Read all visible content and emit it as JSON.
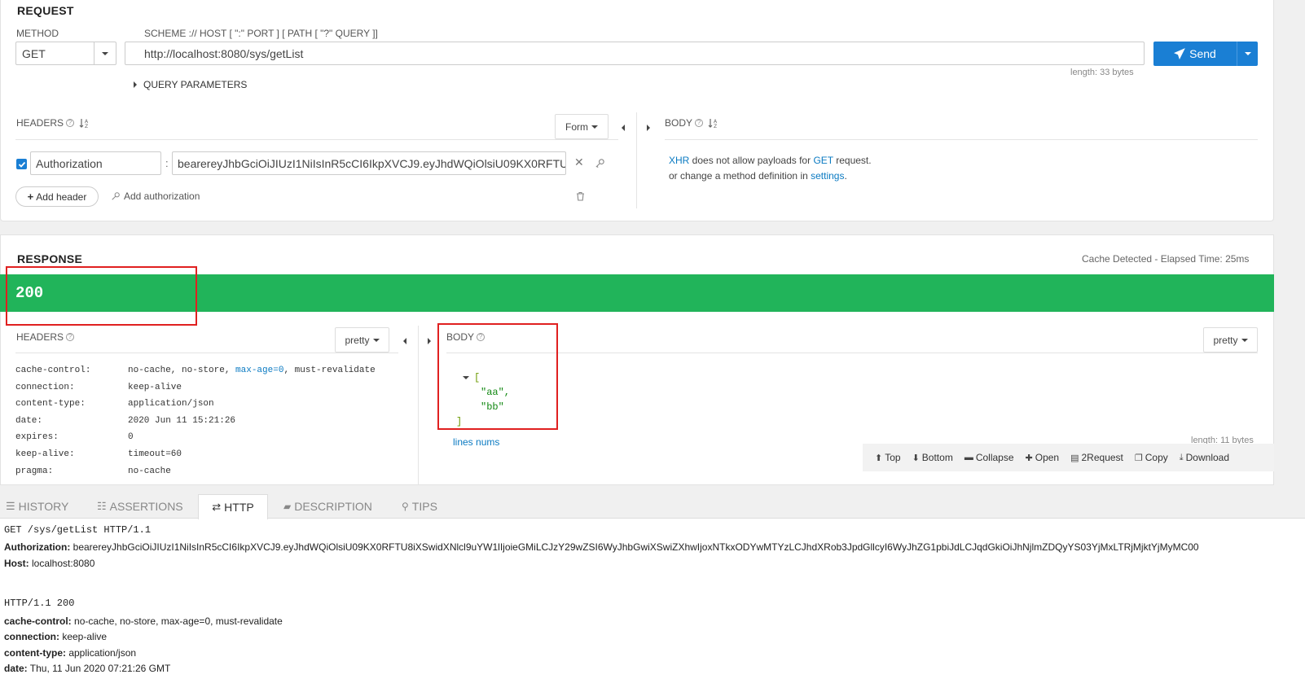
{
  "request": {
    "title": "REQUEST",
    "method_label": "METHOD",
    "method_value": "GET",
    "url_label": "SCHEME :// HOST [ \":\" PORT ] [ PATH [ \"?\" QUERY ]]",
    "url_value": "http://localhost:8080/sys/getList",
    "send_label": "Send",
    "length_text": "length: 33 bytes",
    "query_params_label": "QUERY PARAMETERS",
    "headers_label": "HEADERS",
    "form_button": "Form",
    "header_name": "Authorization",
    "header_separator": ":",
    "header_value": "bearereyJhbGciOiJIUzI1NiIsInR5cCI6IkpXVCJ9.eyJhdWQiOlsiU09KX0RFTU",
    "add_header_label": "Add header",
    "add_authorization_label": "Add authorization",
    "body_label": "BODY",
    "body_msg_xhr": "XHR",
    "body_msg_1": " does not allow payloads for ",
    "body_msg_get": "GET",
    "body_msg_2": " request.",
    "body_msg_3": "or change a method definition in ",
    "body_msg_settings": "settings",
    "body_msg_dot": "."
  },
  "response": {
    "title": "RESPONSE",
    "cache_info": "Cache Detected - Elapsed Time: 25ms",
    "status_code": "200",
    "status_color": "#21b45a",
    "headers_label": "HEADERS",
    "pretty_label": "pretty",
    "headers": [
      {
        "key": "cache-control:",
        "val_pre": "no-cache, no-store, ",
        "val_link": "max-age=0",
        "val_post": ", must-revalidate"
      },
      {
        "key": "connection:",
        "val_pre": "keep-alive",
        "val_link": "",
        "val_post": ""
      },
      {
        "key": "content-type:",
        "val_pre": "application/json",
        "val_link": "",
        "val_post": ""
      },
      {
        "key": "date:",
        "val_pre": "2020 Jun 11 15:21:26",
        "val_link": "",
        "val_post": ""
      },
      {
        "key": "expires:",
        "val_pre": "0",
        "val_link": "",
        "val_post": ""
      },
      {
        "key": "keep-alive:",
        "val_pre": "timeout=60",
        "val_link": "",
        "val_post": ""
      },
      {
        "key": "pragma:",
        "val_pre": "no-cache",
        "val_link": "",
        "val_post": ""
      }
    ],
    "body_label": "BODY",
    "json_open": "[",
    "json_item_1": "\"aa\",",
    "json_item_2": "\"bb\"",
    "json_close": "]",
    "lines_nums": "lines nums",
    "length_text": "length: 11 bytes",
    "toolbar": {
      "top": "Top",
      "bottom": "Bottom",
      "collapse": "Collapse",
      "open": "Open",
      "to_request": "2Request",
      "copy": "Copy",
      "download": "Download"
    },
    "highlight_color": "#e02020"
  },
  "tabs": {
    "history": "HISTORY",
    "assertions": "ASSERTIONS",
    "http": "HTTP",
    "description": "DESCRIPTION",
    "tips": "TIPS"
  },
  "http_log": {
    "request_line": "GET /sys/getList HTTP/1.1",
    "auth_key": "Authorization:",
    "auth_val": " bearereyJhbGciOiJIUzI1NiIsInR5cCI6IkpXVCJ9.eyJhdWQiOlsiU09KX0RFTU8iXSwidXNlcl9uYW1lIjoieGMiLCJzY29wZSI6WyJhbGwiXSwiZXhwIjoxNTkxODYwMTYzLCJhdXRob3JpdGllcyI6WyJhZG1pbiJdLCJqdGkiOiJhNjlmZDQyYS03YjMxLTRjMjktYjMyMC00",
    "host_key": "Host:",
    "host_val": " localhost:8080",
    "response_line": "HTTP/1.1 200",
    "resp_headers": [
      {
        "key": "cache-control:",
        "val": " no-cache, no-store, max-age=0, must-revalidate"
      },
      {
        "key": "connection:",
        "val": " keep-alive"
      },
      {
        "key": "content-type:",
        "val": " application/json"
      },
      {
        "key": "date:",
        "val": " Thu, 11 Jun 2020 07:21:26 GMT"
      }
    ]
  },
  "icons": {
    "send": "paper-plane-icon",
    "sort": "sort-az-icon",
    "help": "question-circle-icon",
    "clear": "close-icon",
    "key": "key-icon",
    "trash": "trash-icon"
  },
  "colors": {
    "accent": "#1a7fd4",
    "json_bracket": "#6b9a00",
    "json_string": "#118811",
    "link": "#0a7ac2"
  }
}
